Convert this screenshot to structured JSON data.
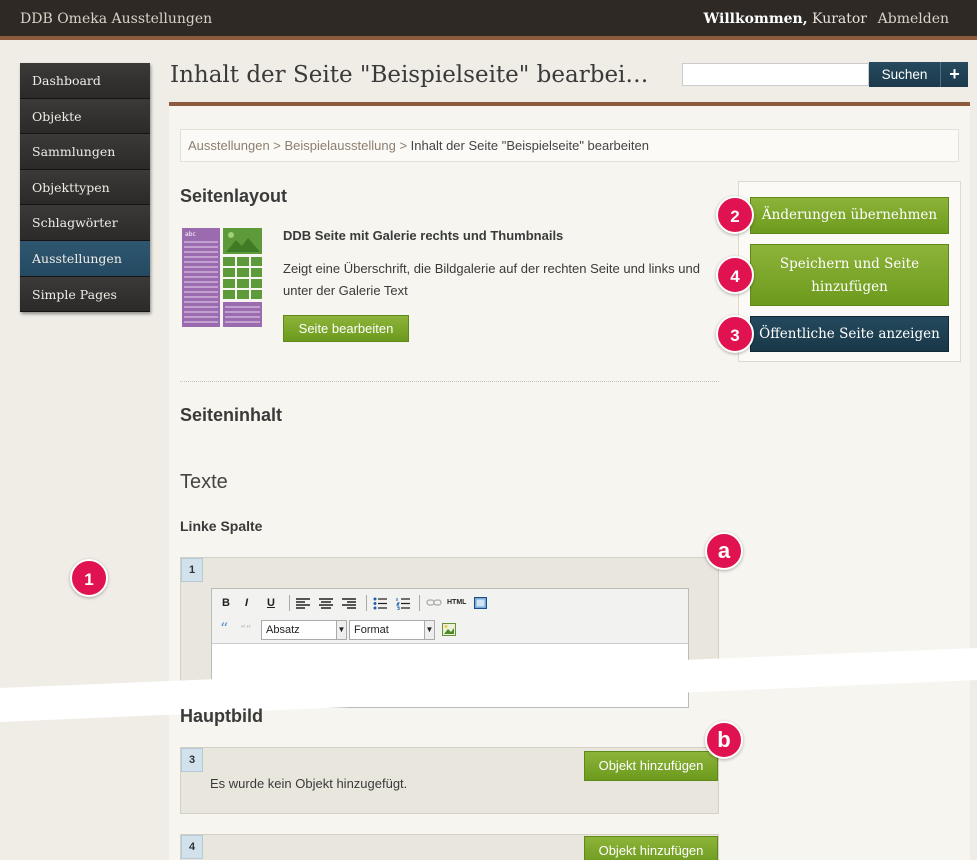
{
  "header": {
    "site_title": "DDB Omeka Ausstellungen",
    "welcome_bold": "Willkommen,",
    "welcome_user": " Kurator",
    "logout": "Abmelden"
  },
  "nav": {
    "items": [
      {
        "label": "Dashboard"
      },
      {
        "label": "Objekte"
      },
      {
        "label": "Sammlungen"
      },
      {
        "label": "Objekttypen"
      },
      {
        "label": "Schlagwörter"
      },
      {
        "label": "Ausstellungen",
        "active": true
      },
      {
        "label": "Simple Pages"
      }
    ]
  },
  "page": {
    "title": "Inhalt der Seite \"Beispielseite\" bearbei…"
  },
  "search": {
    "value": "",
    "button_label": "Suchen",
    "advanced_label": "+"
  },
  "breadcrumb": {
    "items": [
      "Ausstellungen",
      "Beispielausstellung"
    ],
    "separator": ">",
    "current": "Inhalt der Seite \"Beispielseite\" bearbeiten"
  },
  "layout_section": {
    "heading": "Seitenlayout",
    "thumb_label": "abc",
    "layout_name": "DDB Seite mit Galerie rechts und Thumbnails",
    "layout_desc": "Zeigt eine Überschrift, die Bildgalerie auf der rechten Seite und links und unter der Galerie Text",
    "edit_button": "Seite bearbeiten"
  },
  "actions": {
    "apply": "Änderungen übernehmen",
    "save_add": "Speichern und Seite hinzufügen",
    "view_public": "Öffentliche Seite anzeigen"
  },
  "content_section": {
    "heading": "Seiteninhalt",
    "texts_heading": "Texte",
    "left_column_heading": "Linke Spalte",
    "block1_num": "1",
    "main_image_heading": "Hauptbild",
    "block3_num": "3",
    "no_object_text": "Es wurde kein Objekt hinzugefügt.",
    "add_object_button": "Objekt hinzufügen",
    "block4_num": "4"
  },
  "editor": {
    "toolbar": {
      "bold": "B",
      "italic": "I",
      "underline": "U",
      "html": "HTML",
      "quote": "“",
      "paragraph_select": "Absatz",
      "format_select": "Format"
    }
  },
  "markers": {
    "m1": "1",
    "m2": "2",
    "m3": "3",
    "m4": "4",
    "ma": "a",
    "mb": "b"
  },
  "colors": {
    "accent_brown": "#8c5a3c",
    "green_button": "#7aa52a",
    "blue_button": "#1f4153",
    "marker_red": "#e0124f",
    "layout_purple": "#9b6bb0",
    "layout_green": "#5c9a3a"
  }
}
